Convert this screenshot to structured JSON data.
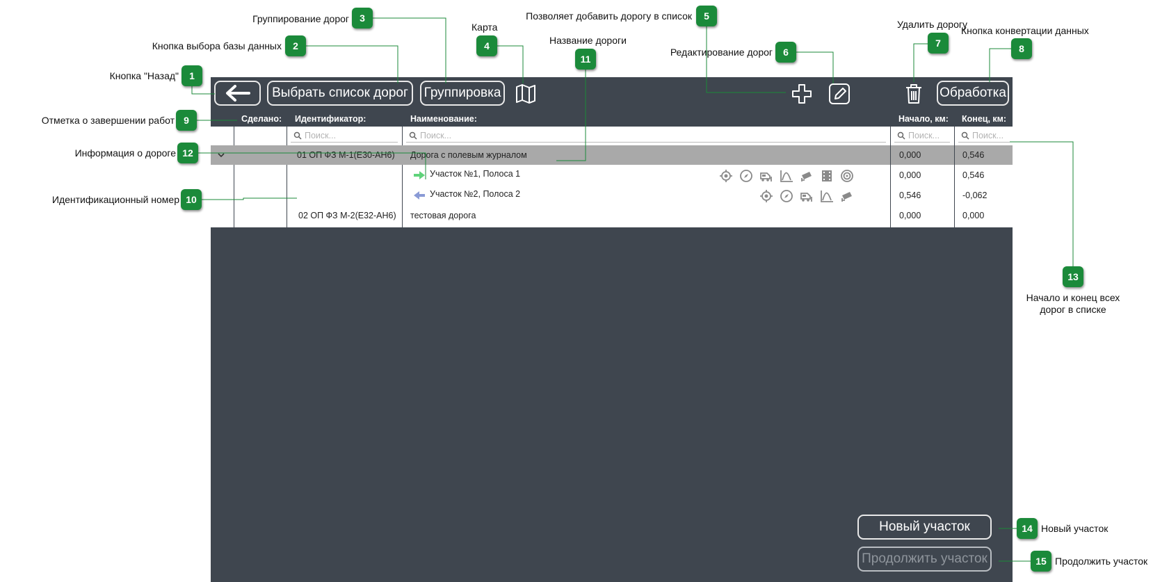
{
  "toolbar": {
    "back_label": "←",
    "select_roads_label": "Выбрать список дорог",
    "grouping_label": "Группировка",
    "processing_label": "Обработка"
  },
  "icons": {
    "map": "map-icon",
    "add": "plus-icon",
    "edit": "edit-icon",
    "delete": "trash-icon"
  },
  "table": {
    "headers": {
      "done": "Сделано:",
      "id": "Идентификатор:",
      "name": "Наименование:",
      "start": "Начало, км:",
      "end": "Конец, км:"
    },
    "search_placeholder": "Поиск...",
    "rows": [
      {
        "id": "01 ОП ФЗ М-1(Е30-АН6)",
        "name": "Дорога с полевым журналом",
        "start": "0,000",
        "end": "0,546"
      },
      {
        "name": "Участок №1, Полоса 1",
        "start": "0,000",
        "end": "0,546"
      },
      {
        "name": "Участок №2, Полоса 2",
        "start": "0,546",
        "end": "-0,062"
      },
      {
        "id": "02 ОП ФЗ М-2(Е32-АН6)",
        "name": "тестовая дорога",
        "start": "0,000",
        "end": "0,000"
      }
    ]
  },
  "bottom": {
    "new_section_label": "Новый участок",
    "continue_section_label": "Продолжить участок"
  },
  "callouts": [
    {
      "number": "1",
      "text": "Кнопка \"Назад\""
    },
    {
      "number": "2",
      "text": "Кнопка выбора базы данных"
    },
    {
      "number": "3",
      "text": "Группирование дорог"
    },
    {
      "number": "4",
      "text": "Карта"
    },
    {
      "number": "5",
      "text": "Позволяет добавить дорогу в список"
    },
    {
      "number": "6",
      "text": "Редактирование дорог"
    },
    {
      "number": "7",
      "text": "Удалить дорогу"
    },
    {
      "number": "8",
      "text": "Кнопка конвертации данных"
    },
    {
      "number": "9",
      "text": "Отметка о завершении работ"
    },
    {
      "number": "10",
      "text": "Идентификационный номер"
    },
    {
      "number": "11",
      "text": "Название дороги"
    },
    {
      "number": "12",
      "text": "Информация о дороге"
    },
    {
      "number": "13",
      "text": "Начало и конец всех дорог в списке"
    },
    {
      "number": "14",
      "text": "Новый участок"
    },
    {
      "number": "15",
      "text": "Продолжить участок"
    }
  ],
  "colors": {
    "app_background": "#3f464f",
    "badge_green": "#1b8a3a",
    "selected_row": "#a9a9a9",
    "arrow_green": "#5fd37a",
    "arrow_blue": "#8a9bd6"
  }
}
